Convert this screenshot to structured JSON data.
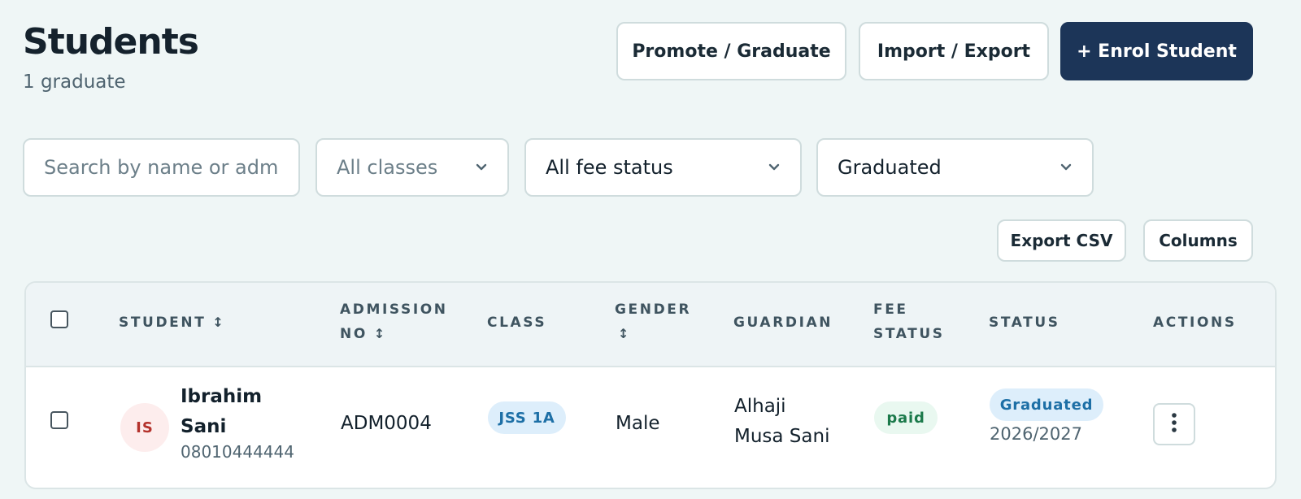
{
  "header": {
    "title": "Students",
    "subtitle": "1 graduate",
    "promote_label": "Promote / Graduate",
    "import_label": "Import / Export",
    "enrol_label": "+ Enrol Student"
  },
  "filters": {
    "search_placeholder": "Search by name or admission no",
    "class_value": "All classes",
    "fee_value": "All fee status",
    "status_value": "Graduated"
  },
  "toolbar": {
    "export_label": "Export CSV",
    "columns_label": "Columns"
  },
  "table": {
    "headers": {
      "student": "STUDENT",
      "admission_line1": "ADMISSION",
      "admission_line2": "NO",
      "class": "CLASS",
      "gender": "GENDER",
      "guardian": "GUARDIAN",
      "fee_line1": "FEE",
      "fee_line2": "STATUS",
      "status": "STATUS",
      "actions": "ACTIONS"
    },
    "rows": [
      {
        "initials": "IS",
        "name_line1": "Ibrahim",
        "name_line2": "Sani",
        "phone": "08010444444",
        "admission_no": "ADM0004",
        "class": "JSS 1A",
        "gender": "Male",
        "guardian_line1": "Alhaji",
        "guardian_line2": "Musa Sani",
        "fee_status": "paid",
        "status": "Graduated",
        "session": "2026/2027"
      }
    ]
  },
  "colors": {
    "background": "#eff6f6",
    "primary": "#1c3558",
    "class_pill_bg": "#ddeefb",
    "class_pill_text": "#1d6fa6",
    "paid_bg": "#e9f8f0",
    "paid_text": "#1c7a4b",
    "graduated_bg": "#ddeefb",
    "graduated_text": "#1d6fa6",
    "avatar_bg": "#fdeded",
    "avatar_text": "#b4322c"
  },
  "icons": {
    "dropdown": "chevron-down-icon",
    "sort": "sort-arrows-icon",
    "row_actions": "more-vertical-icon"
  }
}
